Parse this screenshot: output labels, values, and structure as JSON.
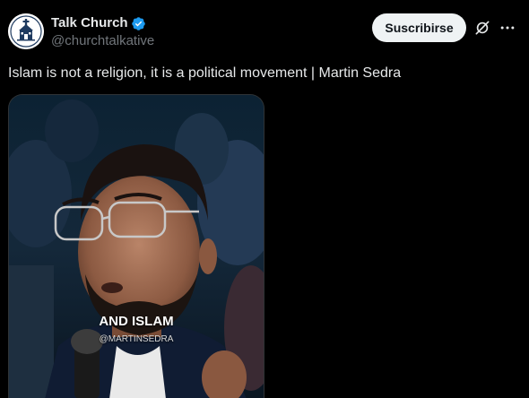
{
  "author": {
    "display_name": "Talk Church",
    "handle": "@churchtalkative",
    "verified_icon": "verified-badge-icon",
    "avatar_icon": "church-logo-icon"
  },
  "actions": {
    "subscribe_label": "Suscribirse",
    "grok_icon": "grok-icon",
    "more_icon": "more-options-icon"
  },
  "post": {
    "text": "Islam is not a religion, it is a political movement | Martin Sedra"
  },
  "media": {
    "caption_main": "AND ISLAM",
    "caption_sub": "@MARTINSEDRA"
  },
  "colors": {
    "background": "#000000",
    "text_primary": "#e7e9ea",
    "text_secondary": "#71767b",
    "verified_blue": "#1d9bf0",
    "button_bg": "#eff3f4"
  }
}
